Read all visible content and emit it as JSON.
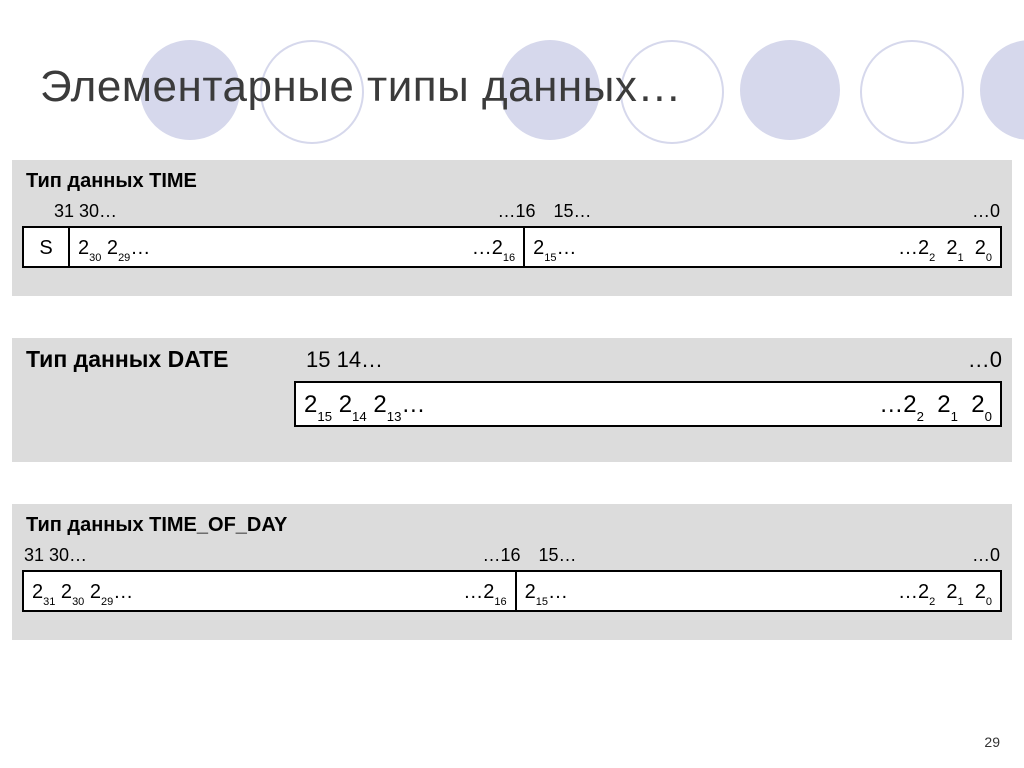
{
  "title": "Элементарные типы данных…",
  "page_number": "29",
  "time": {
    "heading": "Тип данных TIME",
    "bitidx": {
      "hi_left": "31 30…",
      "hi_right": "…16",
      "lo_left": "15…",
      "lo_right": "…0"
    },
    "cells": {
      "s": "S",
      "hi_left": "2³⁰ 2²⁹…",
      "hi_right": "…2¹⁶",
      "lo_left": "2¹⁵…",
      "lo_right": "…2²  2¹  2⁰"
    }
  },
  "date": {
    "heading": "Тип данных DATE",
    "bitidx": {
      "left": "15 14…",
      "right": "…0"
    },
    "cells": {
      "left": "2¹⁵ 2¹⁴ 2¹³…",
      "right": "…2²  2¹  2⁰"
    }
  },
  "tod": {
    "heading": "Тип данных TIME_OF_DAY",
    "bitidx": {
      "hi_left": "31 30…",
      "hi_right": "…16",
      "lo_left": "15…",
      "lo_right": "…0"
    },
    "cells": {
      "hi_left": "2³¹ 2³⁰ 2²⁹…",
      "hi_right": "…2¹⁶",
      "lo_left": "2¹⁵…",
      "lo_right": "…2²  2¹  2⁰"
    }
  }
}
